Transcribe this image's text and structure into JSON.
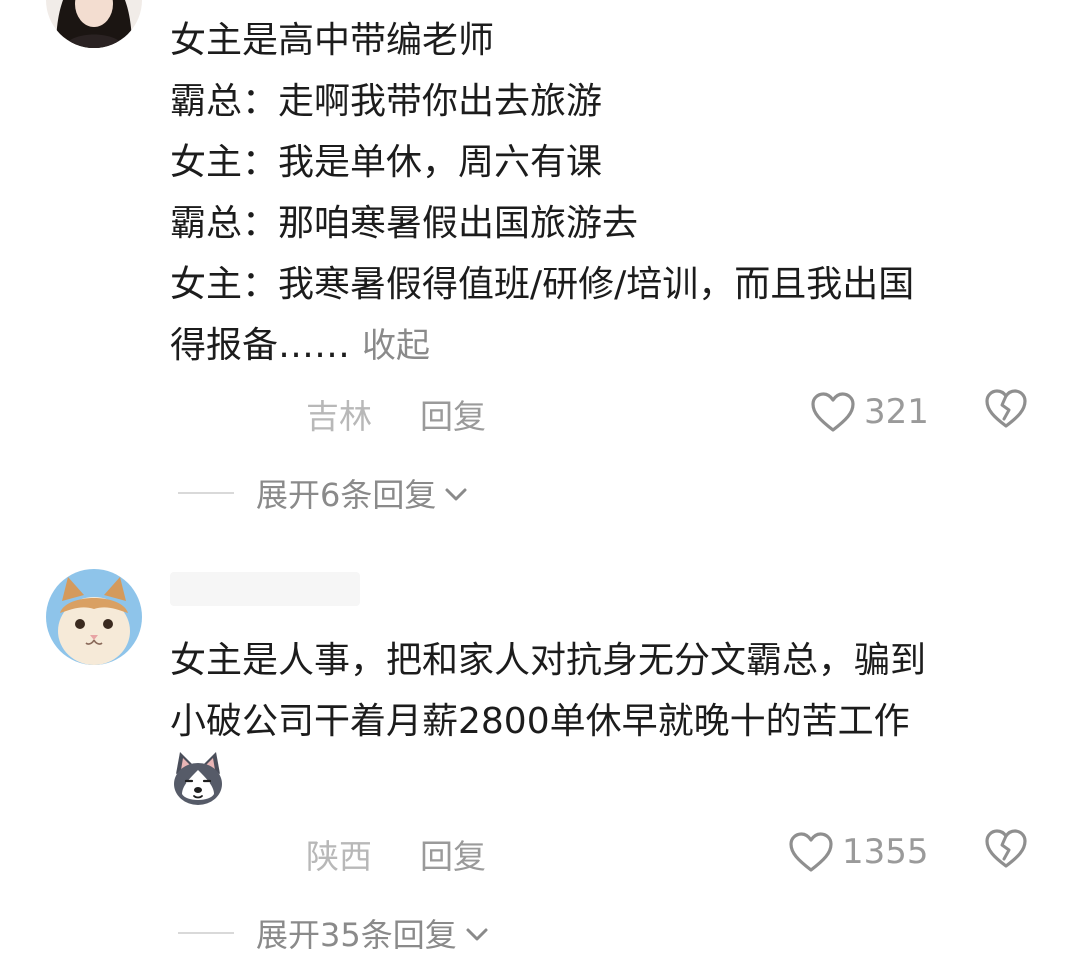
{
  "comments": [
    {
      "lines": [
        "女主是高中带编老师",
        "霸总：走啊我带你出去旅游",
        "女主：我是单休，周六有课",
        "霸总：那咱寒暑假出国旅游去",
        "女主：我寒暑假得值班/研修/培训，而且我出国",
        "得报备……"
      ],
      "collapse_label": "收起",
      "location": "吉林",
      "reply_label": "回复",
      "like_count": "321",
      "expand_label": "展开6条回复"
    },
    {
      "lines": [
        "女主是人事，把和家人对抗身无分文霸总，骗到",
        "小破公司干着月薪2800单休早就晚十的苦工作"
      ],
      "sticker": "husky-dog-emoji",
      "location": "陕西",
      "reply_label": "回复",
      "like_count": "1355",
      "expand_label": "展开35条回复"
    }
  ],
  "icons": {
    "like": "heart-outline-icon",
    "dislike": "broken-heart-icon",
    "expand": "chevron-down-icon"
  },
  "colors": {
    "text": "#1c1c1c",
    "meta": "#9a9a9a",
    "location": "#b8b8b8"
  }
}
